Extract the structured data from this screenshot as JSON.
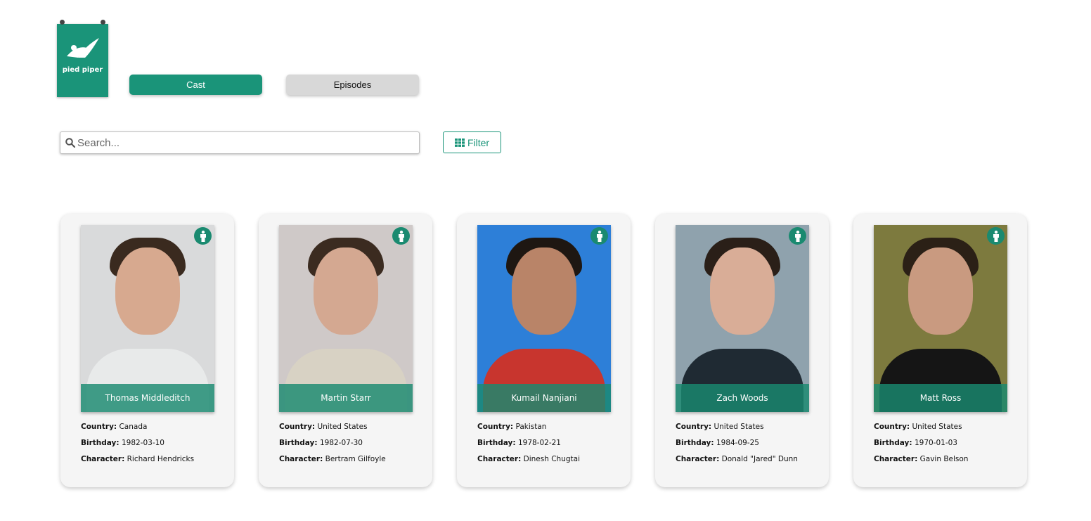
{
  "logo": {
    "text": "pied piper"
  },
  "nav": {
    "cast_label": "Cast",
    "episodes_label": "Episodes"
  },
  "search": {
    "placeholder": "Search...",
    "value": ""
  },
  "filter": {
    "label": "Filter"
  },
  "labels": {
    "country": "Country:",
    "birthday": "Birthday:",
    "character": "Character:"
  },
  "colors": {
    "accent": "#1a9479",
    "inactive_tab": "#d8d8d8",
    "card_bg": "#f5f5f5"
  },
  "cast": [
    {
      "name": "Thomas Middleditch",
      "country": "Canada",
      "birthday": "1982-03-10",
      "character": "Richard Hendricks",
      "gender_icon": "male-icon"
    },
    {
      "name": "Martin Starr",
      "country": "United States",
      "birthday": "1982-07-30",
      "character": "Bertram Gilfoyle",
      "gender_icon": "male-icon"
    },
    {
      "name": "Kumail Nanjiani",
      "country": "Pakistan",
      "birthday": "1978-02-21",
      "character": "Dinesh Chugtai",
      "gender_icon": "male-icon"
    },
    {
      "name": "Zach Woods",
      "country": "United States",
      "birthday": "1984-09-25",
      "character": "Donald \"Jared\" Dunn",
      "gender_icon": "male-icon"
    },
    {
      "name": "Matt Ross",
      "country": "United States",
      "birthday": "1970-01-03",
      "character": "Gavin Belson",
      "gender_icon": "male-icon"
    }
  ]
}
